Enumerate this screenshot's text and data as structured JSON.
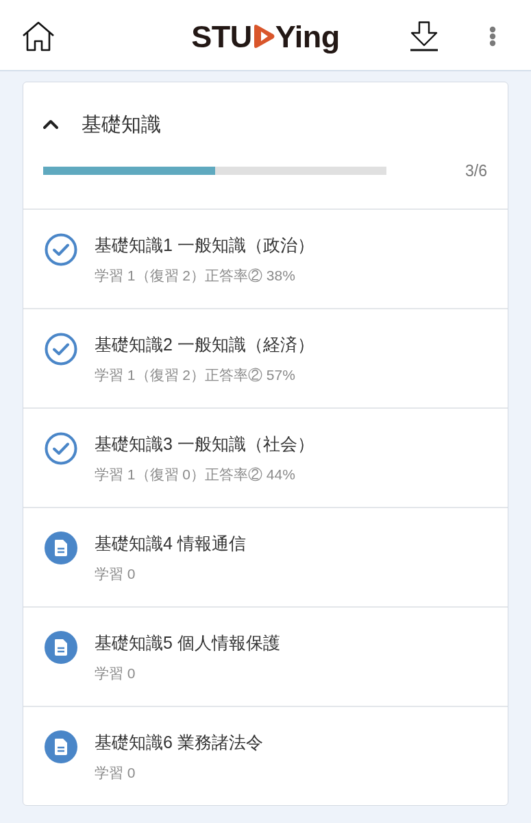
{
  "header": {
    "logo": {
      "before": "STU",
      "after": "Ying"
    }
  },
  "section": {
    "title": "基礎知識",
    "expanded": true,
    "progress": {
      "level": 0.5,
      "reading": "3/6"
    }
  },
  "lessons": [
    {
      "title": "基礎知識1 一般知識（政治）",
      "detail": "学習 1（復習 2）正答率② 38%",
      "completed": true
    },
    {
      "title": "基礎知識2 一般知識（経済）",
      "detail": "学習 1（復習 2）正答率② 57%",
      "completed": true
    },
    {
      "title": "基礎知識3 一般知識（社会）",
      "detail": "学習 1（復習 0）正答率② 44%",
      "completed": true
    },
    {
      "title": "基礎知識4 情報通信",
      "detail": "学習 0",
      "completed": false
    },
    {
      "title": "基礎知識5 個人情報保護",
      "detail": "学習 0",
      "completed": false
    },
    {
      "title": "基礎知識6 業務諸法令",
      "detail": "学習 0",
      "completed": false
    }
  ]
}
